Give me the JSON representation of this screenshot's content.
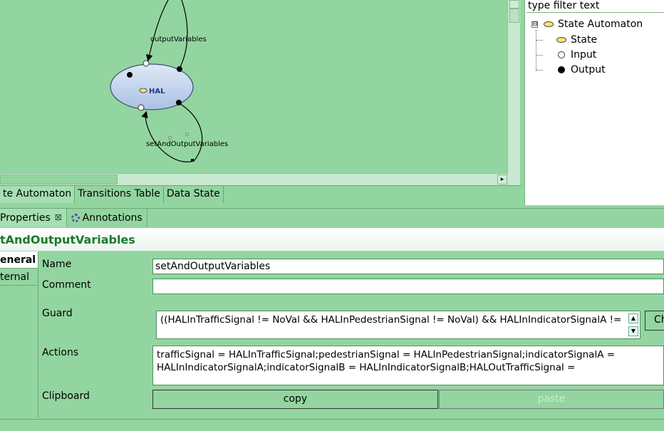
{
  "diagram": {
    "state_label": "HAL",
    "transition_top_label": "outputVariables",
    "transition_bottom_label": "setAndOutputVariables"
  },
  "editor_tabs": [
    {
      "label": "te Automaton",
      "active": true
    },
    {
      "label": "Transitions Table",
      "active": false
    },
    {
      "label": "Data State",
      "active": false
    }
  ],
  "outline": {
    "filter_placeholder": "type filter text",
    "expander": "⊟",
    "root_label": "State Automaton",
    "children": [
      {
        "label": "State",
        "icon": "state-ellipse-icon"
      },
      {
        "label": "Input",
        "icon": "input-circle-icon"
      },
      {
        "label": "Output",
        "icon": "output-dot-icon"
      }
    ]
  },
  "properties": {
    "tabs": [
      {
        "label": "Properties",
        "close": "☒"
      },
      {
        "label": "Annotations"
      }
    ],
    "title": "tAndOutputVariables",
    "side_tabs": [
      {
        "label": "eneral",
        "active": true
      },
      {
        "label": "ternal",
        "active": false
      }
    ],
    "fields": {
      "name_label": "Name",
      "name_value": "setAndOutputVariables",
      "comment_label": "Comment",
      "comment_value": "",
      "guard_label": "Guard",
      "guard_value": "((HALInTrafficSignal != NoVal && HALInPedestrianSignal != NoVal) && HALInIndicatorSignalA !=",
      "guard_button": "Ch",
      "actions_label": "Actions",
      "actions_value_line1": "trafficSignal = HALInTrafficSignal;pedestrianSignal = HALInPedestrianSignal;indicatorSignalA =",
      "actions_value_line2": "HALInIndicatorSignalA;indicatorSignalB = HALInIndicatorSignalB;HALOutTrafficSignal =",
      "clipboard_label": "Clipboard",
      "copy_label": "copy",
      "paste_label": "paste"
    }
  },
  "colors": {
    "background": "#93d5a0",
    "state_fill": "#c3d6ef",
    "title_text": "#1a7a2a"
  }
}
